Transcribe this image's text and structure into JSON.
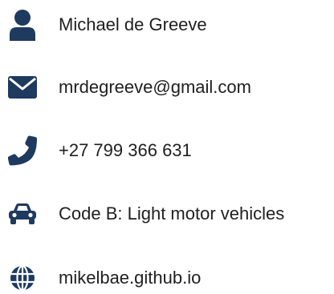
{
  "contact": {
    "name": "Michael de Greeve",
    "email": "mrdegreeve@gmail.com",
    "phone": "+27 799 366 631",
    "license": "Code B: Light motor vehicles",
    "website": "mikelbae.github.io"
  },
  "icons": {
    "name": "user-icon",
    "email": "envelope-icon",
    "phone": "phone-icon",
    "license": "car-icon",
    "website": "globe-icon"
  },
  "colors": {
    "icon": "#1e3a5f",
    "text": "#1f1f1f"
  }
}
